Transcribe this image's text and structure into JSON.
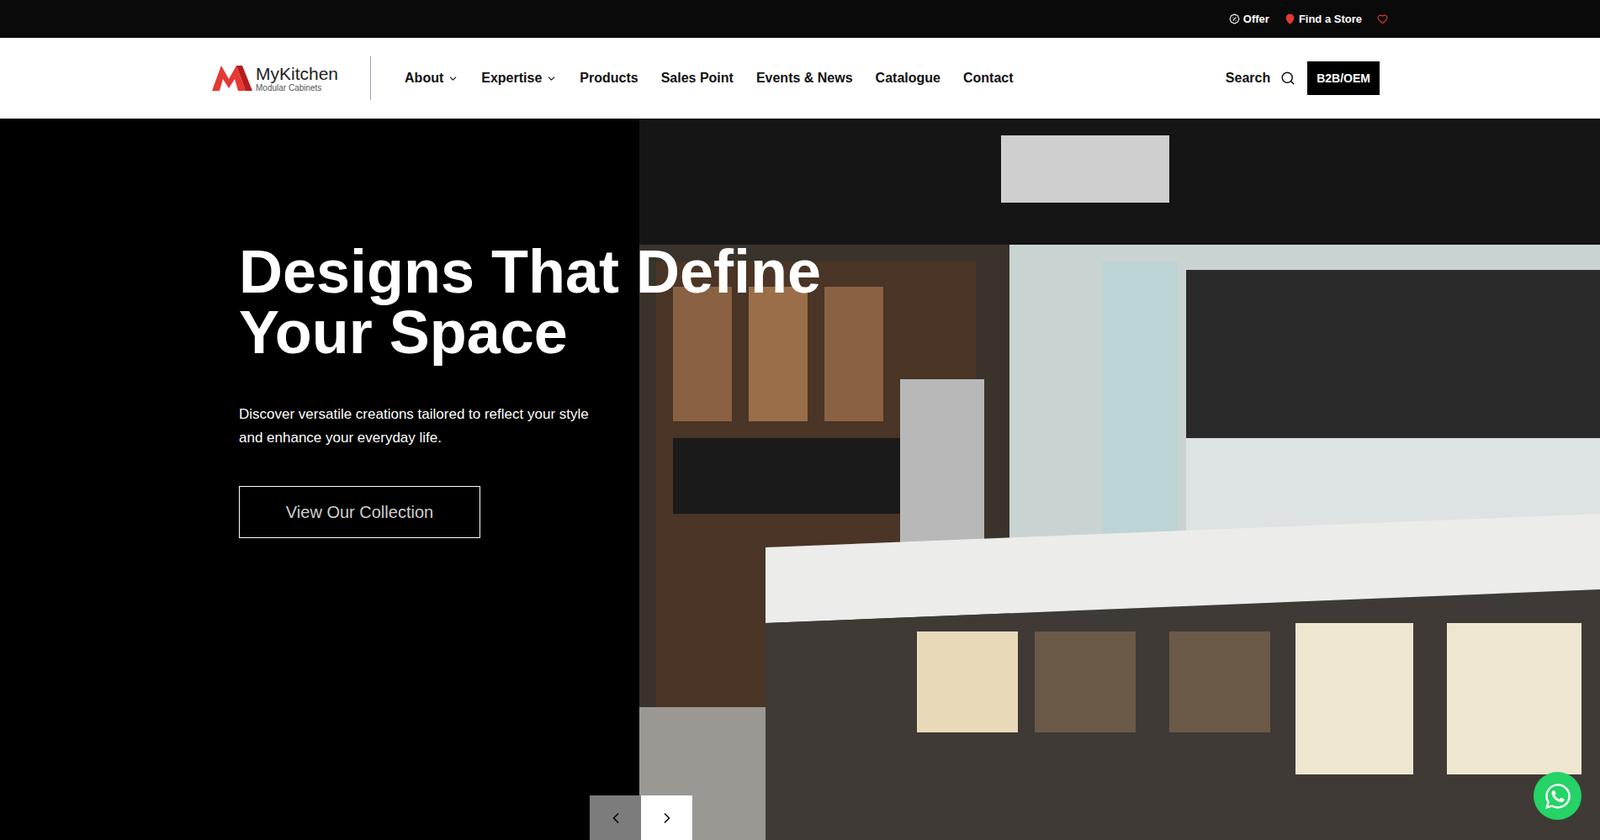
{
  "top_bar": {
    "links": [
      {
        "label": "Offer",
        "kind": "offer"
      },
      {
        "label": "Find a Store",
        "kind": "store"
      }
    ]
  },
  "nav": {
    "logo": {
      "name": "MyKitchen",
      "tagline": "Modular Cabinets"
    },
    "items": [
      {
        "label": "About",
        "dropdown": true
      },
      {
        "label": "Expertise",
        "dropdown": true
      },
      {
        "label": "Products",
        "dropdown": false
      },
      {
        "label": "Sales Point",
        "dropdown": false
      },
      {
        "label": "Events & News",
        "dropdown": false
      },
      {
        "label": "Catalogue",
        "dropdown": false
      },
      {
        "label": "Contact",
        "dropdown": false
      }
    ],
    "search": "Search",
    "cta": "B2B/OEM"
  },
  "hero": {
    "title_lines": [
      "Designs That Define",
      "Your Space"
    ],
    "description": "Discover versatile creations tailored to reflect your style and enhance your everyday life.",
    "button": "View Our Collection"
  },
  "carousel": {
    "buttons": [
      {
        "kind": "prev",
        "highlighted": true
      },
      {
        "kind": "next",
        "highlighted": false
      }
    ]
  }
}
